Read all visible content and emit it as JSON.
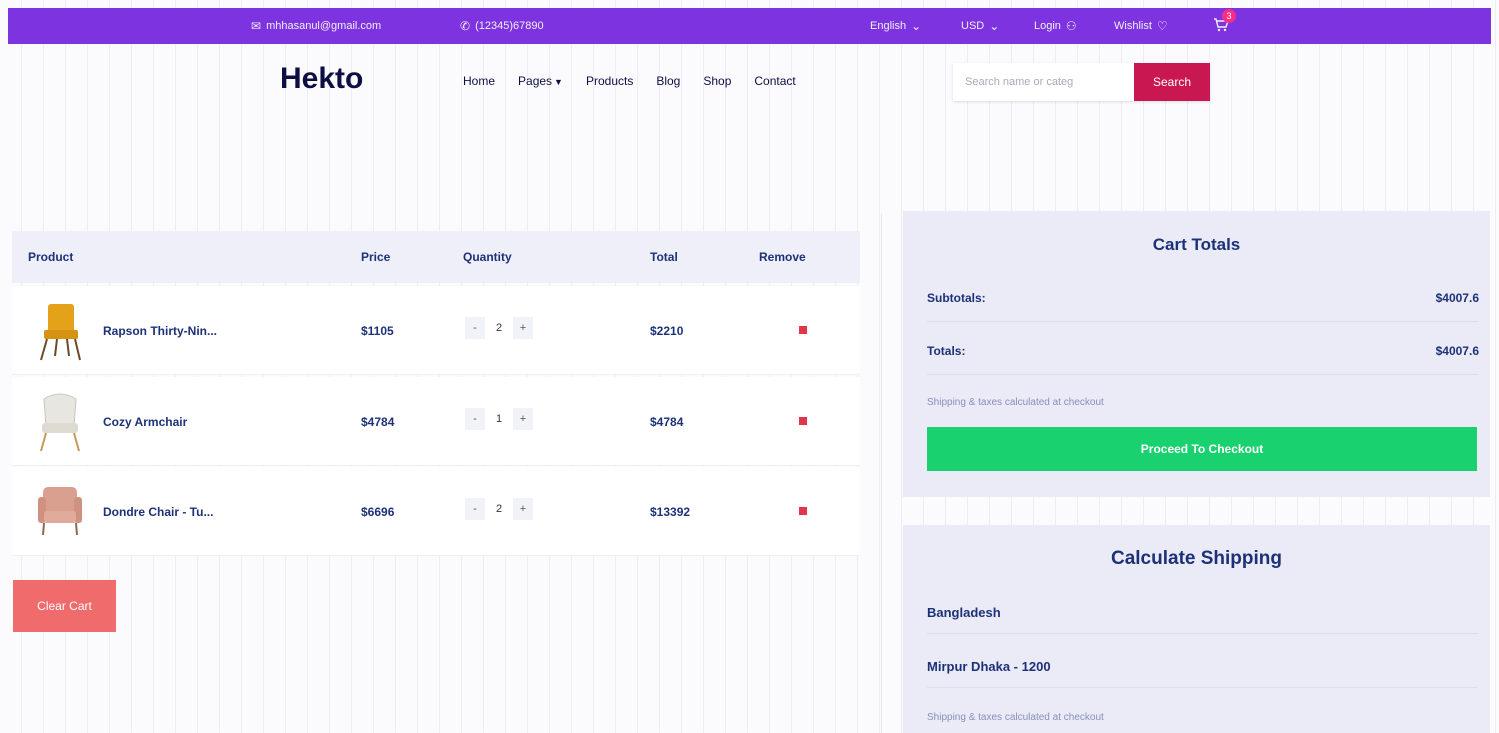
{
  "topbar": {
    "email": "mhhasanul@gmail.com",
    "phone": "(12345)67890",
    "language": "English",
    "currency": "USD",
    "login": "Login",
    "wishlist": "Wishlist",
    "cart_count": "3",
    "background": "#7e33e0"
  },
  "header": {
    "logo": "Hekto",
    "nav": [
      "Home",
      "Pages",
      "Products",
      "Blog",
      "Shop",
      "Contact"
    ],
    "search_placeholder": "Search name or categ",
    "search_button": "Search"
  },
  "cart": {
    "columns": [
      "Product",
      "Price",
      "Quantity",
      "Total",
      "Remove"
    ],
    "items": [
      {
        "name": "Rapson Thirty-Nin...",
        "price": "$1105",
        "quantity": "2",
        "total": "$2210",
        "image_icon": "yellow-chair"
      },
      {
        "name": "Cozy Armchair",
        "price": "$4784",
        "quantity": "1",
        "total": "$4784",
        "image_icon": "white-armchair"
      },
      {
        "name": "Dondre Chair - Tu...",
        "price": "$6696",
        "quantity": "2",
        "total": "$13392",
        "image_icon": "pink-chair"
      }
    ],
    "clear_button": "Clear Cart",
    "qty_minus": "-",
    "qty_plus": "+"
  },
  "totals": {
    "title": "Cart Totals",
    "subtotal_label": "Subtotals:",
    "subtotal_value": "$4007.6",
    "total_label": "Totals:",
    "total_value": "$4007.6",
    "note": "Shipping & taxes calculated at checkout",
    "checkout_button": "Proceed To Checkout",
    "checkout_color": "#19d16f"
  },
  "shipping": {
    "title": "Calculate Shipping",
    "country": "Bangladesh",
    "city": "Mirpur Dhaka - 1200",
    "note": "Shipping & taxes calculated at checkout"
  }
}
